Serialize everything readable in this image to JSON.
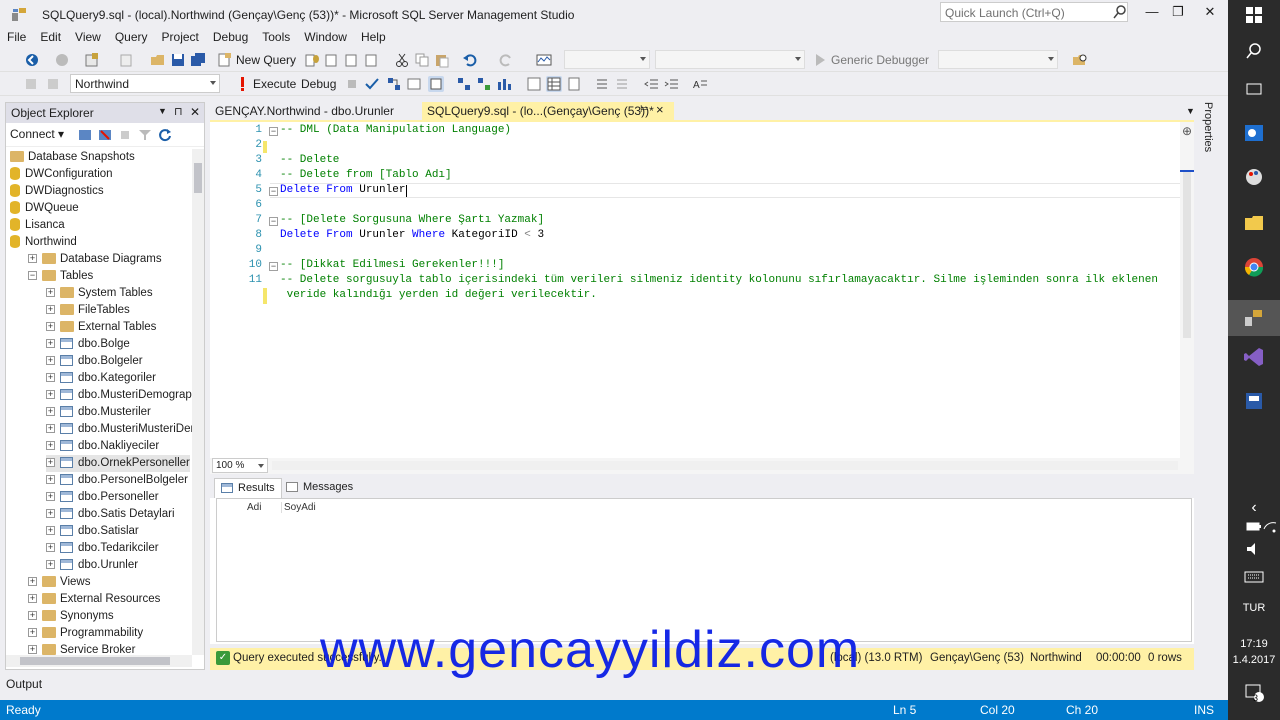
{
  "window": {
    "title": "SQLQuery9.sql - (local).Northwind (Gençay\\Genç (53))* - Microsoft SQL Server Management Studio",
    "quick_launch_placeholder": "Quick Launch (Ctrl+Q)"
  },
  "menu": [
    "File",
    "Edit",
    "View",
    "Query",
    "Project",
    "Debug",
    "Tools",
    "Window",
    "Help"
  ],
  "toolbar1": {
    "new_query": "New Query",
    "generic_debugger": "Generic Debugger"
  },
  "toolbar2": {
    "database": "Northwind",
    "execute": "Execute",
    "debug": "Debug"
  },
  "object_explorer": {
    "title": "Object Explorer",
    "connect": "Connect",
    "nodes": [
      {
        "label": "Database Snapshots",
        "type": "folder",
        "level": 0,
        "exp": ""
      },
      {
        "label": "DWConfiguration",
        "type": "db",
        "level": 0,
        "exp": ""
      },
      {
        "label": "DWDiagnostics",
        "type": "db",
        "level": 0,
        "exp": ""
      },
      {
        "label": "DWQueue",
        "type": "db",
        "level": 0,
        "exp": ""
      },
      {
        "label": "Lisanca",
        "type": "db",
        "level": 0,
        "exp": ""
      },
      {
        "label": "Northwind",
        "type": "db",
        "level": 0,
        "exp": ""
      },
      {
        "label": "Database Diagrams",
        "type": "folder",
        "level": 1,
        "exp": "+"
      },
      {
        "label": "Tables",
        "type": "folder",
        "level": 1,
        "exp": "−"
      },
      {
        "label": "System Tables",
        "type": "folder",
        "level": 2,
        "exp": "+"
      },
      {
        "label": "FileTables",
        "type": "folder",
        "level": 2,
        "exp": "+"
      },
      {
        "label": "External Tables",
        "type": "folder",
        "level": 2,
        "exp": "+"
      },
      {
        "label": "dbo.Bolge",
        "type": "table",
        "level": 2,
        "exp": "+"
      },
      {
        "label": "dbo.Bolgeler",
        "type": "table",
        "level": 2,
        "exp": "+"
      },
      {
        "label": "dbo.Kategoriler",
        "type": "table",
        "level": 2,
        "exp": "+"
      },
      {
        "label": "dbo.MusteriDemographi",
        "type": "table",
        "level": 2,
        "exp": "+"
      },
      {
        "label": "dbo.Musteriler",
        "type": "table",
        "level": 2,
        "exp": "+"
      },
      {
        "label": "dbo.MusteriMusteriDemo",
        "type": "table",
        "level": 2,
        "exp": "+"
      },
      {
        "label": "dbo.Nakliyeciler",
        "type": "table",
        "level": 2,
        "exp": "+"
      },
      {
        "label": "dbo.OrnekPersoneller",
        "type": "table",
        "level": 2,
        "exp": "+",
        "selected": true
      },
      {
        "label": "dbo.PersonelBolgeler",
        "type": "table",
        "level": 2,
        "exp": "+"
      },
      {
        "label": "dbo.Personeller",
        "type": "table",
        "level": 2,
        "exp": "+"
      },
      {
        "label": "dbo.Satis Detaylari",
        "type": "table",
        "level": 2,
        "exp": "+"
      },
      {
        "label": "dbo.Satislar",
        "type": "table",
        "level": 2,
        "exp": "+"
      },
      {
        "label": "dbo.Tedarikciler",
        "type": "table",
        "level": 2,
        "exp": "+"
      },
      {
        "label": "dbo.Urunler",
        "type": "table",
        "level": 2,
        "exp": "+"
      },
      {
        "label": "Views",
        "type": "folder",
        "level": 1,
        "exp": "+"
      },
      {
        "label": "External Resources",
        "type": "folder",
        "level": 1,
        "exp": "+"
      },
      {
        "label": "Synonyms",
        "type": "folder",
        "level": 1,
        "exp": "+"
      },
      {
        "label": "Programmability",
        "type": "folder",
        "level": 1,
        "exp": "+"
      },
      {
        "label": "Service Broker",
        "type": "folder",
        "level": 1,
        "exp": "+"
      }
    ]
  },
  "tabs": {
    "tab1": "GENÇAY.Northwind - dbo.Urunler",
    "tab2": "SQLQuery9.sql - (lo...(Gençay\\Genç (53))*",
    "pin": "⊨",
    "close": "×"
  },
  "editor": {
    "lines": [
      {
        "n": "1",
        "html": "<span class='cm'>-- DML (Data Manipulation Language)</span>",
        "collapse": "−"
      },
      {
        "n": "2",
        "html": ""
      },
      {
        "n": "3",
        "html": "<span class='cm'>-- Delete</span>"
      },
      {
        "n": "4",
        "html": "<span class='cm'>-- Delete from [Tablo Adı]</span>"
      },
      {
        "n": "5",
        "html": "<span class='kw'>Delete From</span> Urunler",
        "collapse": "−"
      },
      {
        "n": "6",
        "html": ""
      },
      {
        "n": "7",
        "html": "<span class='cm'>-- [Delete Sorgusuna Where Şartı Yazmak]</span>",
        "collapse": "−"
      },
      {
        "n": "8",
        "html": "<span class='kw'>Delete From</span> Urunler <span class='kw'>Where</span> KategoriID <span class='op'>&lt;</span> 3"
      },
      {
        "n": "9",
        "html": ""
      },
      {
        "n": "10",
        "html": "<span class='cm'>-- [Dikkat Edilmesi Gerekenler!!!]</span>",
        "collapse": "−"
      },
      {
        "n": "11",
        "html": "<span class='cm'>-- Delete sorgusuyla tablo içerisindeki tüm verileri silmeniz identity kolonunu sıfırlamayacaktır. Silme işleminden sonra ilk eklenen</span>"
      },
      {
        "n": "",
        "html": "<span class='cm'> veride kalındığı yerden id değeri verilecektir.</span>"
      }
    ],
    "zoom": "100 %"
  },
  "results": {
    "tab_results": "Results",
    "tab_messages": "Messages",
    "columns": [
      "Adi",
      "SoyAdi"
    ]
  },
  "query_status": {
    "message": "Query executed successfully.",
    "server": "(local) (13.0 RTM)",
    "user": "Gençay\\Genç (53)",
    "database": "Northwind",
    "time": "00:00:00",
    "rows": "0 rows"
  },
  "output_label": "Output",
  "statusbar": {
    "ready": "Ready",
    "ln": "Ln 5",
    "col": "Col 20",
    "ch": "Ch 20",
    "ins": "INS"
  },
  "properties_label": "Properties",
  "taskbar": {
    "lang": "TUR",
    "time": "17:19",
    "date": "1.4.2017",
    "notif": "3"
  },
  "watermark": "www.gencayyildiz.com",
  "colors": {
    "accent": "#007acc",
    "status_yellow": "#fff1a6",
    "keyword": "#0000ff",
    "comment": "#008000",
    "watermark": "#0a1ee6"
  }
}
